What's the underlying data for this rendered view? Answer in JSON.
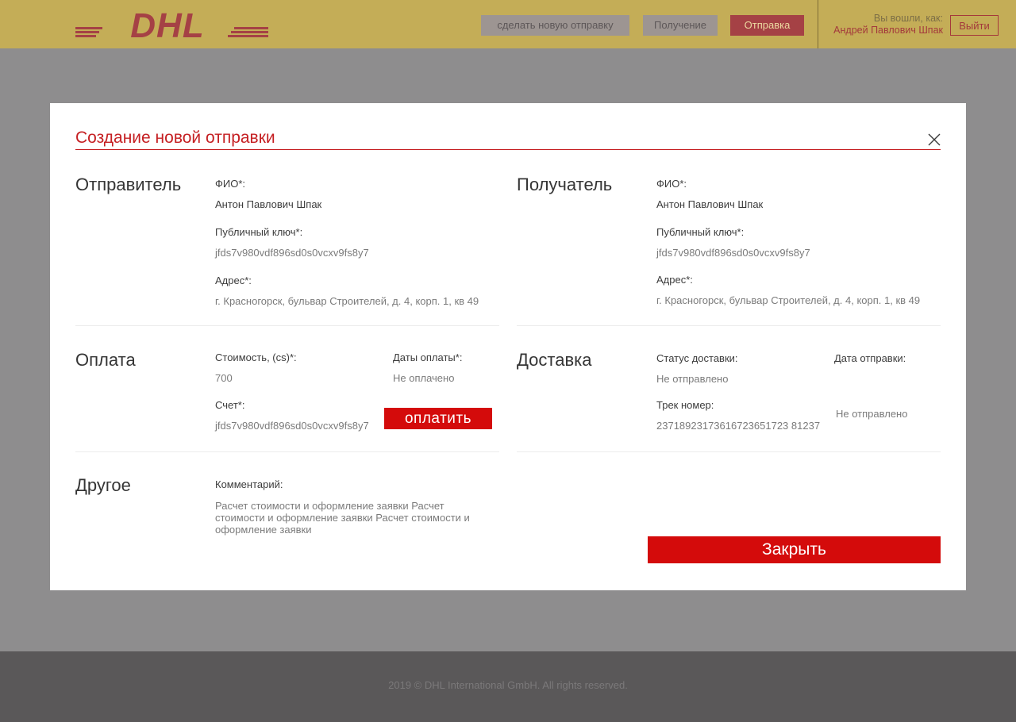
{
  "header": {
    "logo_text": "DHL",
    "nav": {
      "new_shipment": "сделать новую отправку",
      "receiving": "Получение",
      "sending": "Отправка"
    },
    "login_label": "Вы вошли, как:",
    "user_name": "Андрей Павлович Шпак",
    "logout": "Выйти"
  },
  "modal": {
    "title": "Создание новой отправки",
    "sender": {
      "heading": "Отправитель",
      "name_label": "ФИО*:",
      "name": "Антон Павлович Шпак",
      "key_label": "Публичный ключ*:",
      "key": "jfds7v980vdf896sd0s0vcxv9fs8y7",
      "address_label": "Адрес*:",
      "address": "г. Красногорск, бульвар Строителей, д. 4, корп. 1, кв 49"
    },
    "recipient": {
      "heading": "Получатель",
      "name_label": "ФИО*:",
      "name": "Антон Павлович Шпак",
      "key_label": "Публичный ключ*:",
      "key": "jfds7v980vdf896sd0s0vcxv9fs8y7",
      "address_label": "Адрес*:",
      "address": "г. Красногорск, бульвар Строителей, д. 4, корп. 1, кв 49"
    },
    "payment": {
      "heading": "Оплата",
      "cost_label": "Стоимость, (cs)*:",
      "cost": "700",
      "dates_label": "Даты оплаты*:",
      "dates": "Не оплачено",
      "account_label": "Счет*:",
      "account": "jfds7v980vdf896sd0s0vcxv9fs8y7",
      "pay_button": "оплатить"
    },
    "delivery": {
      "heading": "Доставка",
      "status_label": "Статус доставки:",
      "status": "Не отправлено",
      "ship_date_label": "Дата отправки:",
      "ship_date": "Не отправлено",
      "track_label": "Трек номер:",
      "track": "23718923173616723651723 81237"
    },
    "other": {
      "heading": "Другое",
      "comment_label": "Комментарий:",
      "comment": "Расчет стоимости и оформление заявки Расчет стоимости и оформление заявки Расчет стоимости и оформление заявки"
    },
    "close_button": "Закрыть"
  },
  "footer": {
    "copyright": "2019 © DHL International GmbH. All rights reserved."
  },
  "colors": {
    "header_bg": "#c4ad57",
    "brand_red": "#d40b0b",
    "overlay": "#8e8d8e",
    "footer_bg": "#5a5859"
  }
}
